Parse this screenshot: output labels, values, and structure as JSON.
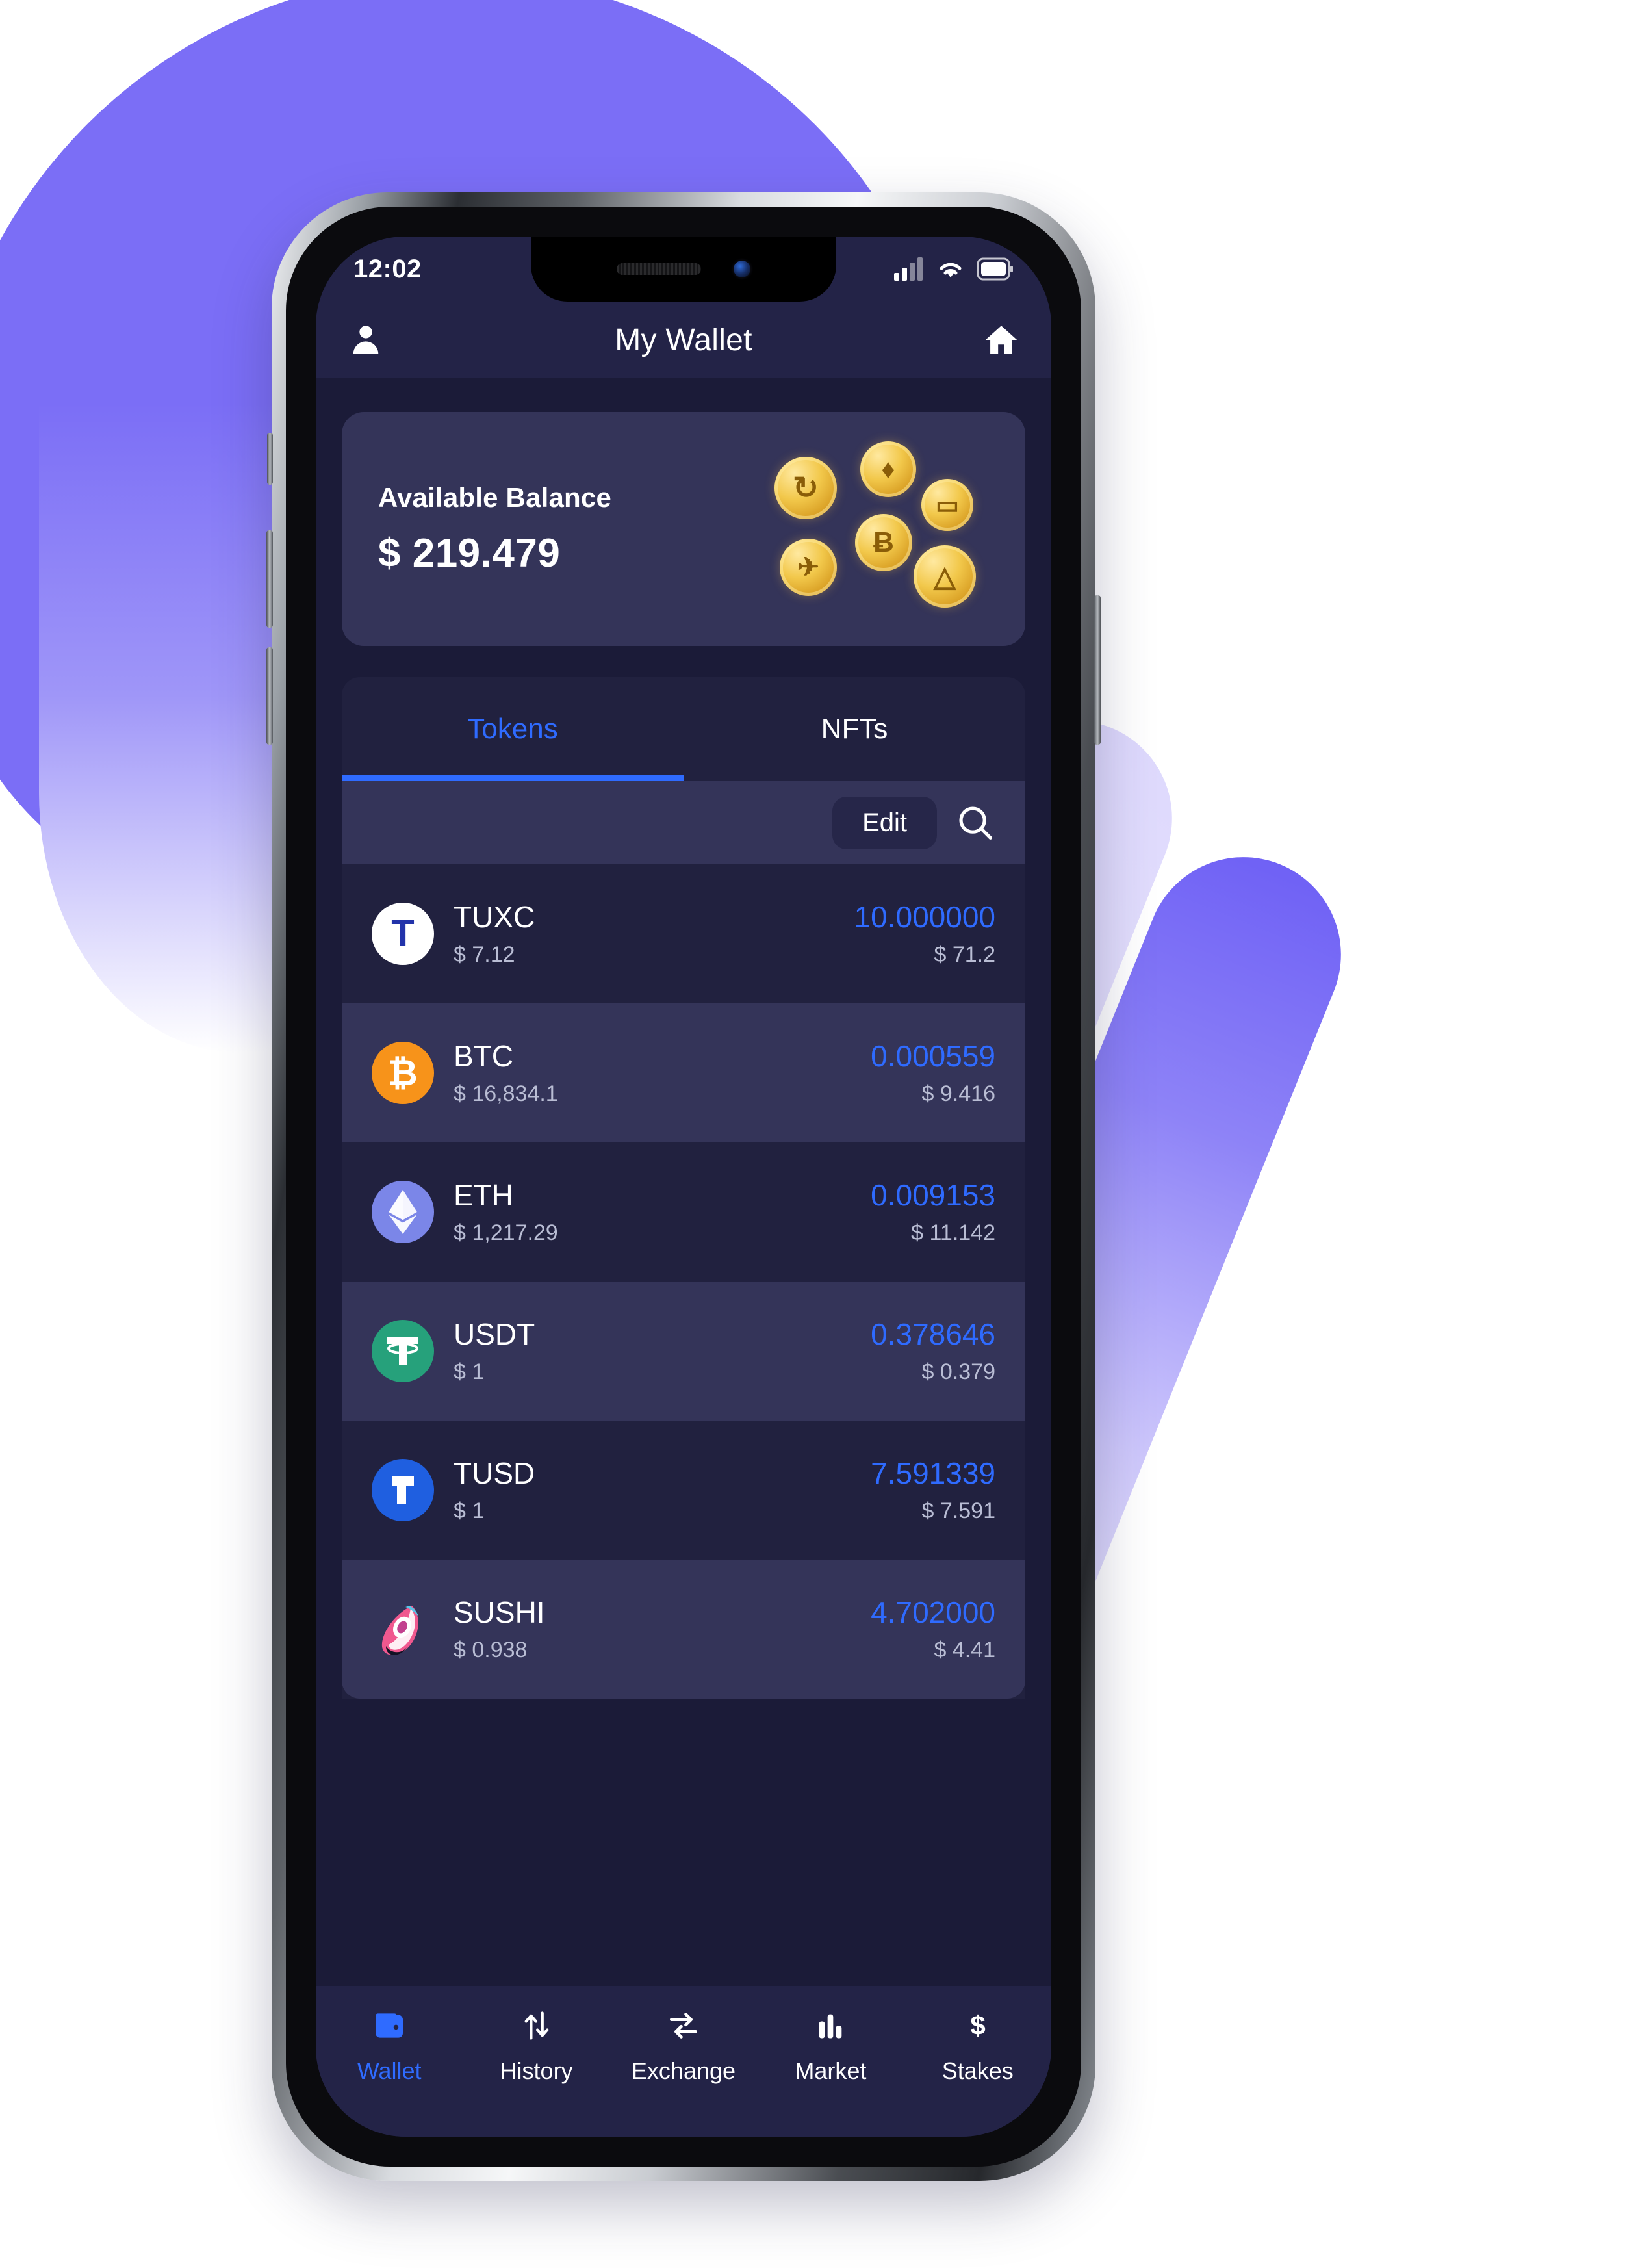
{
  "theme": {
    "accent": "#2f6bff",
    "screen_bg": "#1b1b38",
    "bar_bg": "#232347",
    "card_bg": "#343459",
    "row_alt_bg": "#21213f",
    "muted_text": "#b9bdd4",
    "backdrop_purple": "#7b6ef6"
  },
  "status_bar": {
    "time": "12:02",
    "signal_icon": "cellular-signal-icon",
    "wifi_icon": "wifi-icon",
    "battery_icon": "battery-icon"
  },
  "app_bar": {
    "profile_icon": "person-icon",
    "title": "My Wallet",
    "home_icon": "home-icon"
  },
  "balance": {
    "label": "Available Balance",
    "amount": "$ 219.479",
    "coins": [
      {
        "symbol": "↻",
        "name": "refresh-coin"
      },
      {
        "symbol": "♦",
        "name": "ethereum-coin"
      },
      {
        "symbol": "▭",
        "name": "litecoin-coin"
      },
      {
        "symbol": "Ƀ",
        "name": "bitcoin-coin"
      },
      {
        "symbol": "✈",
        "name": "rocket-coin"
      },
      {
        "symbol": "△",
        "name": "token-coin"
      }
    ]
  },
  "tabs": [
    {
      "label": "Tokens",
      "active": true
    },
    {
      "label": "NFTs",
      "active": false
    }
  ],
  "toolbar": {
    "edit_label": "Edit",
    "search_icon": "search-icon"
  },
  "tokens": [
    {
      "symbol": "TUXC",
      "price": "$ 7.12",
      "quantity": "10.000000",
      "value": "$ 71.2",
      "logo": "tuxc-logo",
      "logo_bg": "#ffffff",
      "logo_fg": "#2233aa",
      "glyph": "T"
    },
    {
      "symbol": "BTC",
      "price": "$ 16,834.1",
      "quantity": "0.000559",
      "value": "$ 9.416",
      "logo": "bitcoin-logo",
      "logo_bg": "#f7931a",
      "logo_fg": "#ffffff",
      "glyph": "₿"
    },
    {
      "symbol": "ETH",
      "price": "$ 1,217.29",
      "quantity": "0.009153",
      "value": "$ 11.142",
      "logo": "ethereum-logo",
      "logo_bg": "#7b86e8",
      "logo_fg": "#ffffff",
      "glyph": "◆"
    },
    {
      "symbol": "USDT",
      "price": "$ 1",
      "quantity": "0.378646",
      "value": "$ 0.379",
      "logo": "tether-logo",
      "logo_bg": "#26a17b",
      "logo_fg": "#ffffff",
      "glyph": "₮"
    },
    {
      "symbol": "TUSD",
      "price": "$ 1",
      "quantity": "7.591339",
      "value": "$ 7.591",
      "logo": "trueusd-logo",
      "logo_bg": "#1f5fe0",
      "logo_fg": "#ffffff",
      "glyph": "T"
    },
    {
      "symbol": "SUSHI",
      "price": "$ 0.938",
      "quantity": "4.702000",
      "value": "$ 4.41",
      "logo": "sushi-logo",
      "logo_bg": "#f0588f",
      "logo_fg": "#ffffff",
      "glyph": "●"
    }
  ],
  "bottom_nav": [
    {
      "label": "Wallet",
      "icon": "wallet-icon",
      "active": true
    },
    {
      "label": "History",
      "icon": "transfer-arrows-icon",
      "active": false
    },
    {
      "label": "Exchange",
      "icon": "swap-icon",
      "active": false
    },
    {
      "label": "Market",
      "icon": "bar-chart-icon",
      "active": false
    },
    {
      "label": "Stakes",
      "icon": "dollar-icon",
      "active": false
    }
  ]
}
